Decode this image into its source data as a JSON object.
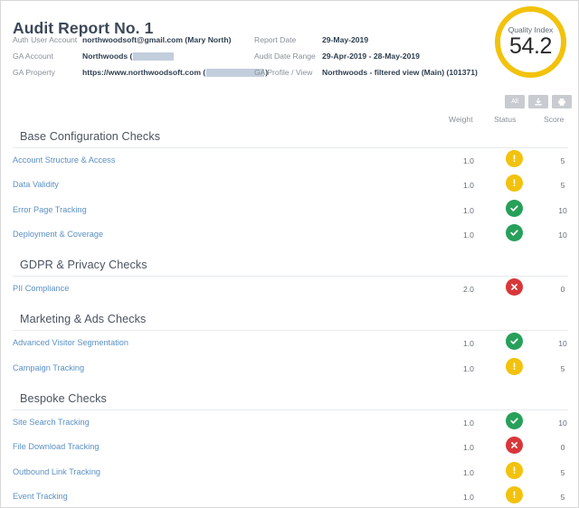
{
  "header": {
    "title": "Audit Report No. 1",
    "meta_left": [
      {
        "label": "Auth User Account",
        "value": "northwoodsoft@gmail.com (Mary North)",
        "redacted": "none"
      },
      {
        "label": "GA Account",
        "value": "Northwoods (",
        "redacted": "small"
      },
      {
        "label": "GA Property",
        "value": "https://www.northwoodsoft.com (",
        "redacted": "large"
      }
    ],
    "meta_right": [
      {
        "label": "Report Date",
        "value": "29-May-2019"
      },
      {
        "label": "Audit Date Range",
        "value": "29-Apr-2019 - 28-May-2019"
      },
      {
        "label": "GA Profile / View",
        "value": "Northwoods - filtered view (Main) (101371)"
      }
    ],
    "gauge": {
      "label": "Quality Index",
      "value": "54.2",
      "ring_color": "#f2c20c"
    }
  },
  "toolbar": {
    "filter_all_label": "All",
    "download_icon": "download-icon",
    "print_icon": "printer-icon"
  },
  "columns": {
    "weight": "Weight",
    "status": "Status",
    "score": "Score"
  },
  "status_colors": {
    "warning": "#f2c20c",
    "pass": "#27a05a",
    "fail": "#d8373a"
  },
  "sections": [
    {
      "title": "Base Configuration Checks",
      "rows": [
        {
          "name": "Account Structure & Access",
          "weight": "1.0",
          "status": "warning",
          "status_icon": "warning-icon",
          "score": "5"
        },
        {
          "name": "Data Validity",
          "weight": "1.0",
          "status": "warning",
          "status_icon": "warning-icon",
          "score": "5"
        },
        {
          "name": "Error Page Tracking",
          "weight": "1.0",
          "status": "pass",
          "status_icon": "check-icon",
          "score": "10"
        },
        {
          "name": "Deployment & Coverage",
          "weight": "1.0",
          "status": "pass",
          "status_icon": "check-icon",
          "score": "10"
        }
      ]
    },
    {
      "title": "GDPR & Privacy Checks",
      "rows": [
        {
          "name": "PII Compliance",
          "weight": "2.0",
          "status": "fail",
          "status_icon": "cross-icon",
          "score": "0"
        }
      ]
    },
    {
      "title": "Marketing & Ads Checks",
      "rows": [
        {
          "name": "Advanced Visitor Segmentation",
          "weight": "1.0",
          "status": "pass",
          "status_icon": "check-icon",
          "score": "10"
        },
        {
          "name": "Campaign Tracking",
          "weight": "1.0",
          "status": "warning",
          "status_icon": "warning-icon",
          "score": "5"
        }
      ]
    },
    {
      "title": "Bespoke Checks",
      "rows": [
        {
          "name": "Site Search Tracking",
          "weight": "1.0",
          "status": "pass",
          "status_icon": "check-icon",
          "score": "10"
        },
        {
          "name": "File Download Tracking",
          "weight": "1.0",
          "status": "fail",
          "status_icon": "cross-icon",
          "score": "0"
        },
        {
          "name": "Outbound Link Tracking",
          "weight": "1.0",
          "status": "warning",
          "status_icon": "warning-icon",
          "score": "5"
        },
        {
          "name": "Event Tracking",
          "weight": "1.0",
          "status": "warning",
          "status_icon": "warning-icon",
          "score": "5"
        }
      ]
    }
  ]
}
